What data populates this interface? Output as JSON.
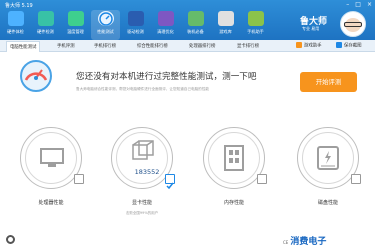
{
  "window": {
    "title": "鲁大师 5.19",
    "controls": [
      "–",
      "□",
      "×"
    ]
  },
  "nav": {
    "items": [
      {
        "label": "硬件体检",
        "icon": "hardware-check-icon",
        "color": "#4db2ff"
      },
      {
        "label": "硬件检测",
        "icon": "hardware-detect-icon",
        "color": "#38c2a6"
      },
      {
        "label": "温度管理",
        "icon": "temperature-icon",
        "color": "#3ecf8e"
      },
      {
        "label": "性能测试",
        "icon": "performance-test-icon",
        "color": "#1e88e5",
        "active": true
      },
      {
        "label": "驱动检测",
        "icon": "driver-icon",
        "color": "#2a5db0"
      },
      {
        "label": "清理优化",
        "icon": "cleanup-icon",
        "color": "#7e57c2"
      },
      {
        "label": "装机必备",
        "icon": "install-icon",
        "color": "#66bb6a"
      },
      {
        "label": "游戏库",
        "icon": "gamepad-icon",
        "color": "#e0e0e0"
      },
      {
        "label": "手机助手",
        "icon": "phone-icon",
        "color": "#8bc34a"
      }
    ]
  },
  "brand": {
    "name": "鲁大师",
    "sub": "专业 易用"
  },
  "tabs": [
    {
      "label": "电脑性能测试",
      "active": true
    },
    {
      "label": "手机评测"
    },
    {
      "label": "手机排行榜"
    },
    {
      "label": "综合性能排行榜"
    },
    {
      "label": "处理器排行榜"
    },
    {
      "label": "显卡排行榜"
    }
  ],
  "tools": {
    "feedback": "游戏助手",
    "save": "保存截图"
  },
  "banner": {
    "headline": "您还没有对本机进行过完整性能测试，测一下吧",
    "subline": "鲁大师电脑综合性能评测，帮您对电脑硬件进行全面测评，让您知道自己电脑的性能",
    "start_button": "开始评测"
  },
  "cards": [
    {
      "label": "处理器性能",
      "icon": "monitor-icon",
      "score": "",
      "sub": ""
    },
    {
      "label": "显卡性能",
      "icon": "3d-cube-icon",
      "score": "183552",
      "sub": "击败全国99%的用户",
      "active": true
    },
    {
      "label": "内存性能",
      "icon": "memory-icon",
      "score": "",
      "sub": ""
    },
    {
      "label": "磁盘性能",
      "icon": "disk-icon",
      "score": "",
      "sub": ""
    }
  ],
  "watermark": {
    "prefix": "CE",
    "text": "消费电子"
  }
}
